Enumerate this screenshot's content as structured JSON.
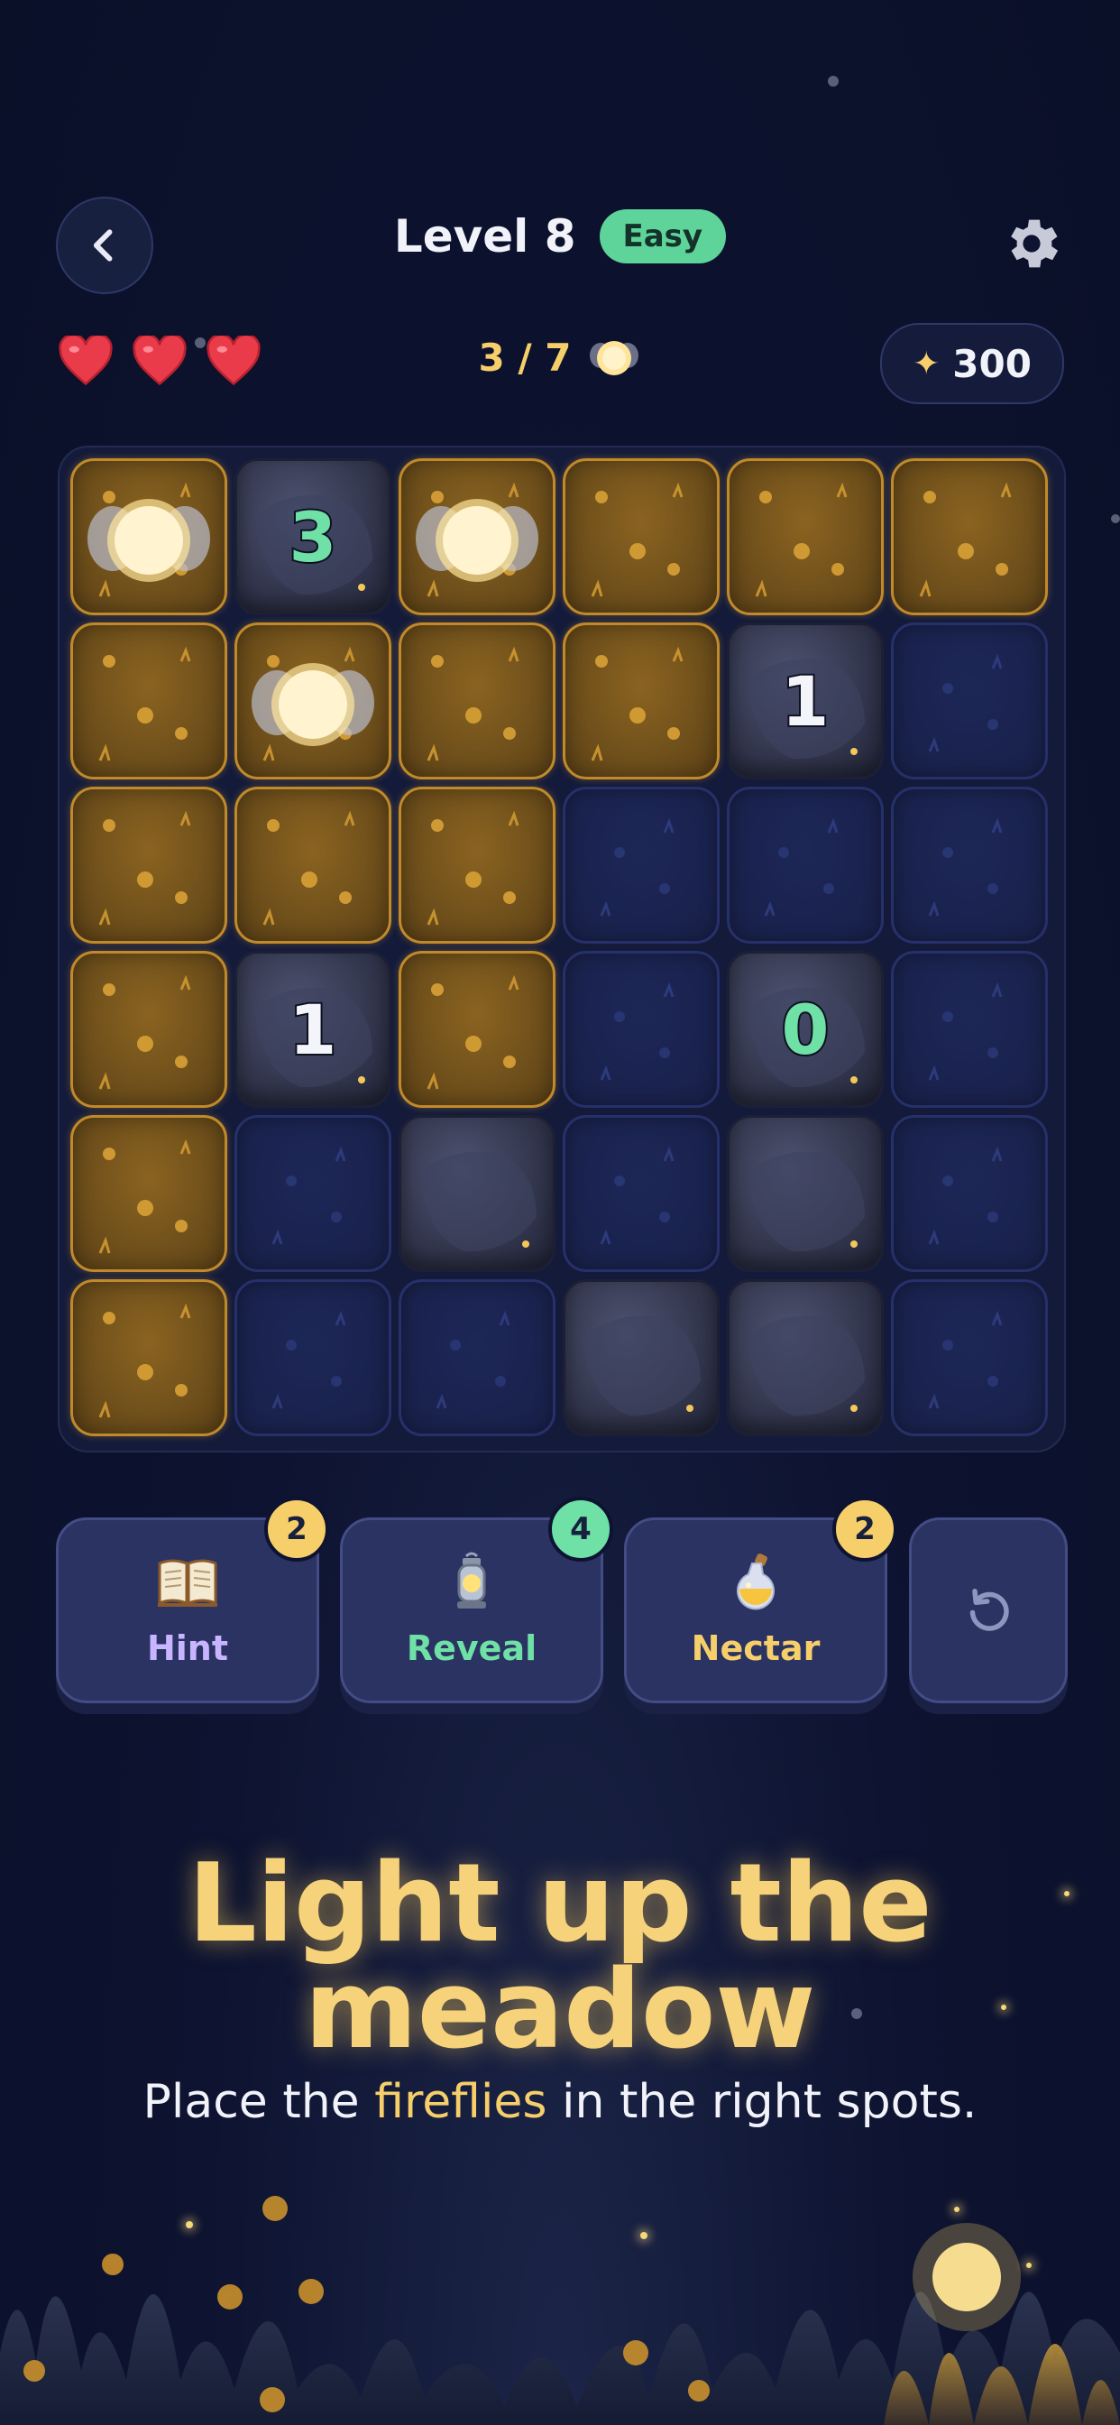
{
  "header": {
    "level_title": "Level 8",
    "difficulty": "Easy"
  },
  "status": {
    "lives": 3,
    "progress": "3 / 7",
    "coins": "300",
    "coin_symbol": "✦"
  },
  "board": {
    "rows": 6,
    "cols": 6,
    "cells": [
      [
        "firefly",
        "rock:3",
        "firefly",
        "lit",
        "lit",
        "lit"
      ],
      [
        "lit",
        "firefly",
        "lit",
        "lit",
        "rock:1",
        "dark"
      ],
      [
        "lit",
        "lit",
        "lit",
        "dark",
        "dark",
        "dark"
      ],
      [
        "lit",
        "rock:1",
        "lit",
        "dark",
        "rock:0",
        "dark"
      ],
      [
        "lit",
        "dark",
        "rock",
        "dark",
        "rock",
        "dark"
      ],
      [
        "lit",
        "dark",
        "dark",
        "rock",
        "rock",
        "dark"
      ]
    ]
  },
  "tools": [
    {
      "label": "Hint",
      "count": "2",
      "icon": "book-icon",
      "color": "#c9b4ff",
      "badge_color": "#f6cf6a"
    },
    {
      "label": "Reveal",
      "count": "4",
      "icon": "lantern-icon",
      "color": "#6fe0a6",
      "badge_color": "#6fe0a6"
    },
    {
      "label": "Nectar",
      "count": "2",
      "icon": "potion-icon",
      "color": "#f6cf6a",
      "badge_color": "#f6cf6a"
    }
  ],
  "undo_icon": "undo-icon",
  "headline": {
    "line1": "Light up the",
    "line2": "meadow"
  },
  "subline": {
    "before": "Place the ",
    "highlight": "fireflies",
    "after": " in the right spots."
  },
  "colors": {
    "background": "#0d1330",
    "accent_gold": "#f6cf6a",
    "accent_green": "#5fd49a"
  }
}
